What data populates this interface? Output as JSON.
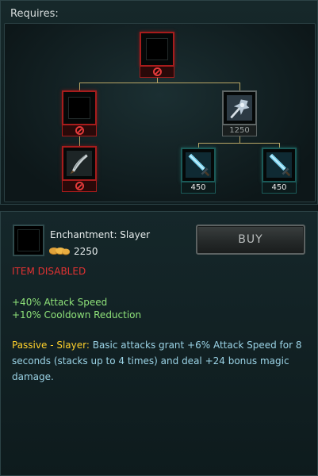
{
  "requires": {
    "title": "Requires:",
    "tree": {
      "root": {
        "name": "Enchantment: Slayer",
        "state": "disabled"
      },
      "left_child": {
        "state": "disabled"
      },
      "left_grandchild": {
        "state": "disabled",
        "icon": "dagger-icon"
      },
      "right_child": {
        "icon": "mace-icon",
        "cost": "1250",
        "state": "dimmed"
      },
      "right_grandchild_1": {
        "icon": "sword-icon",
        "cost": "450",
        "state": "available"
      },
      "right_grandchild_2": {
        "icon": "sword-icon",
        "cost": "450",
        "state": "available"
      }
    }
  },
  "detail": {
    "item_name": "Enchantment: Slayer",
    "cost": "2250",
    "buy_label": "BUY",
    "disabled_label": "ITEM DISABLED",
    "stats": [
      "+40% Attack Speed",
      "+10% Cooldown Reduction"
    ],
    "passive_name": "Passive - Slayer:",
    "passive_text": " Basic attacks grant +6% Attack Speed for 8 seconds (stacks up to 4 times) and deal +24 bonus magic damage."
  },
  "colors": {
    "disabled_red": "#e23232",
    "stat_green": "#8fe37a",
    "passive_gold": "#ffd12b",
    "passive_blue": "#9bd3e6",
    "tree_line": "#b9a766"
  }
}
